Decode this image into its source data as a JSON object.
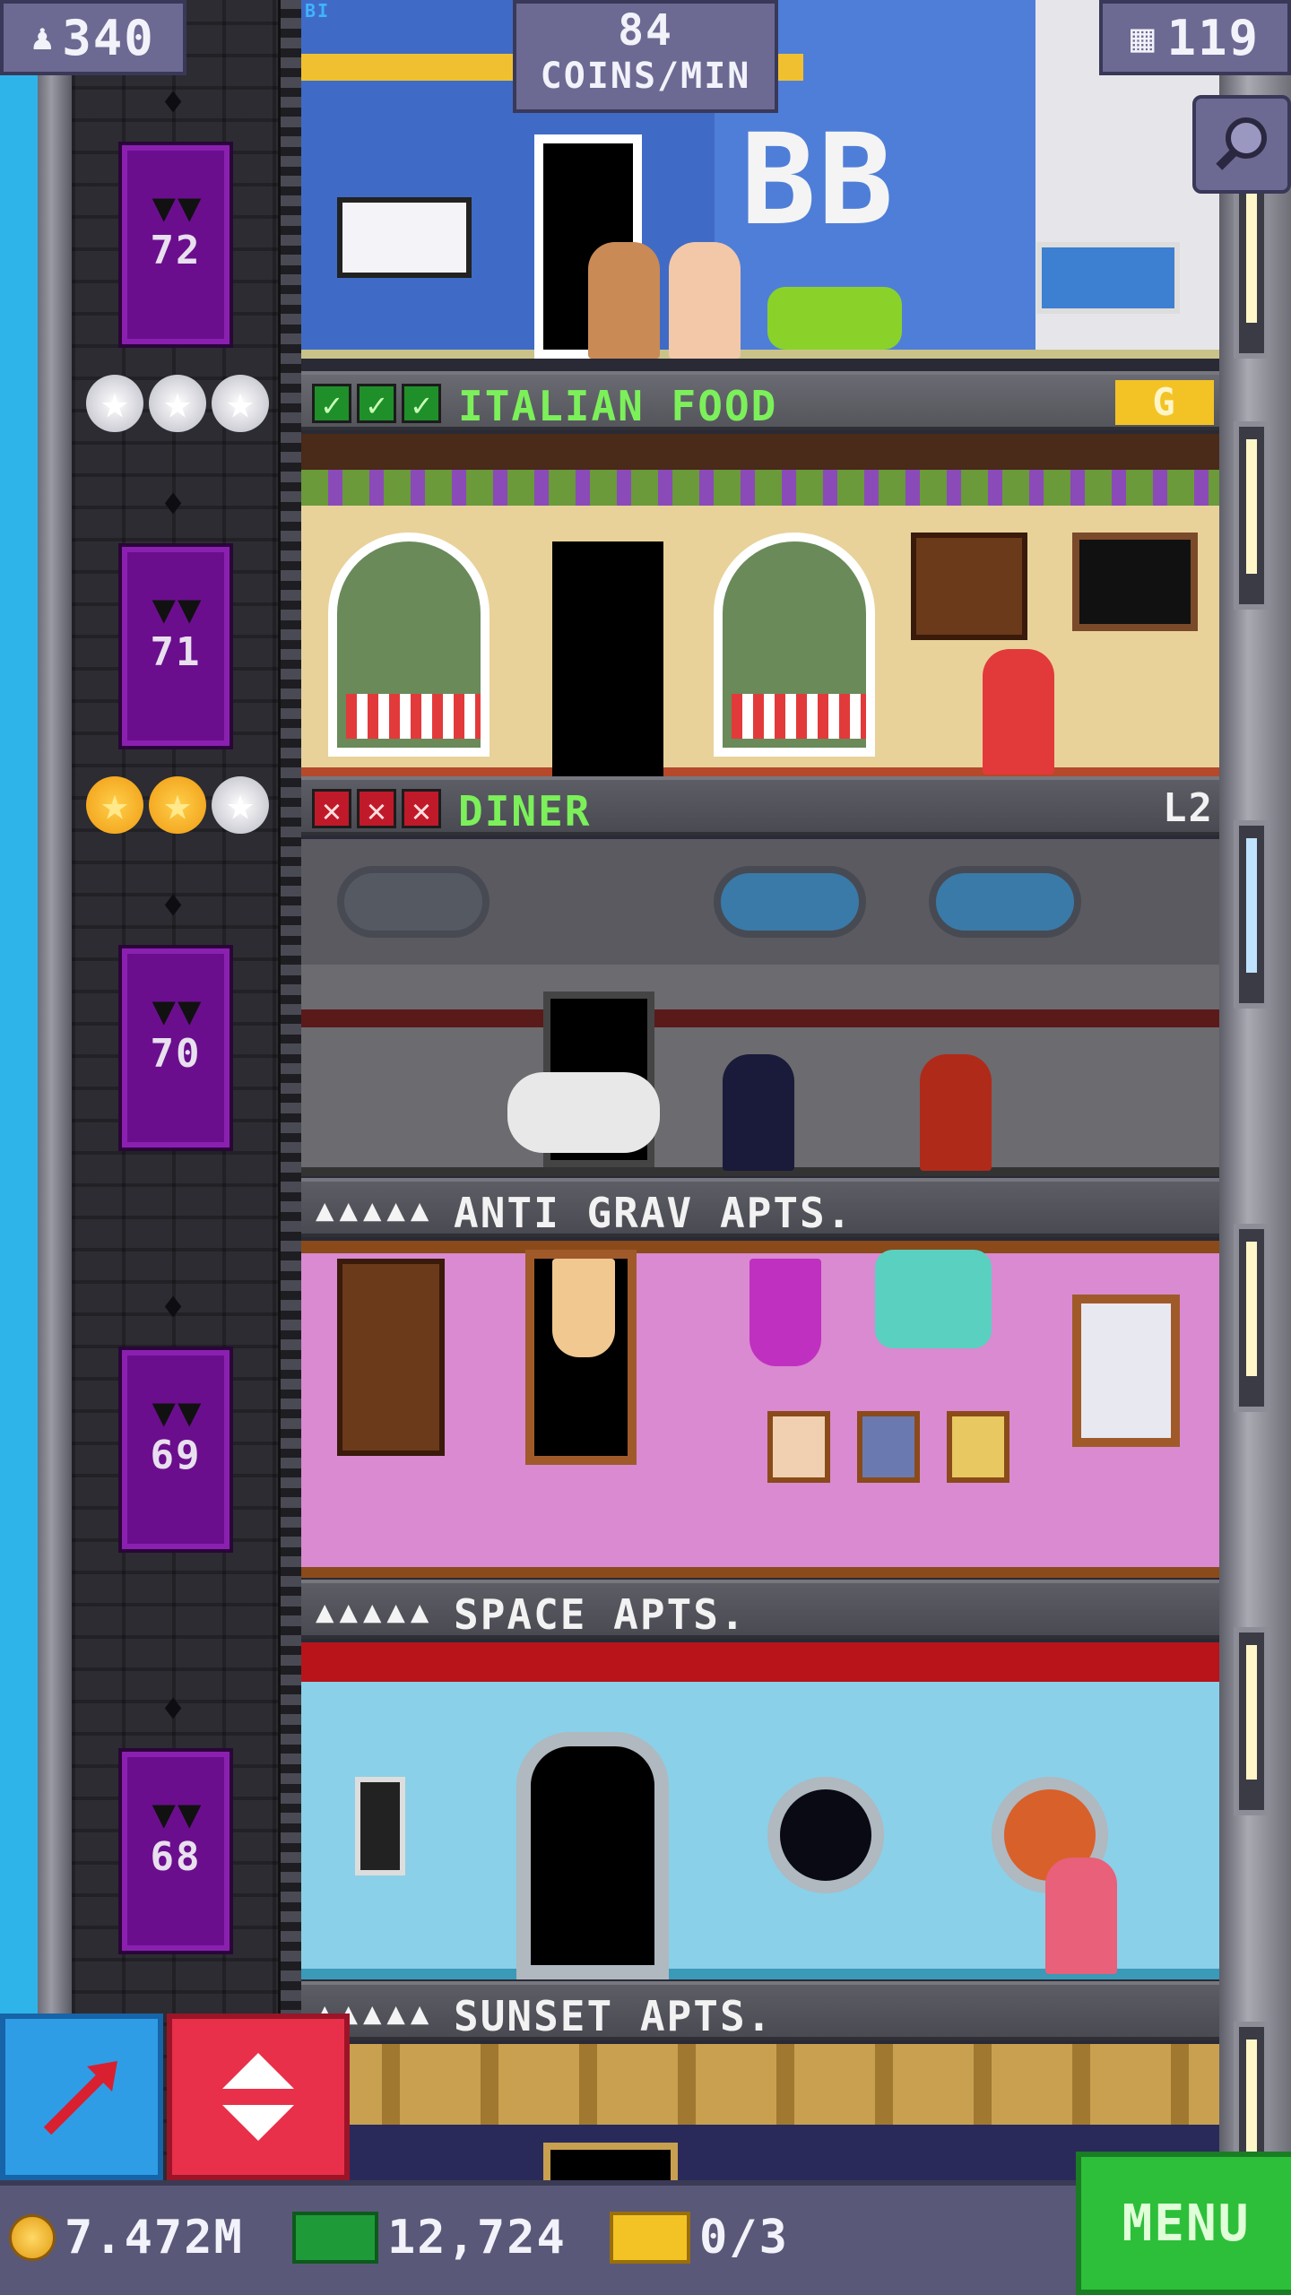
{
  "hud": {
    "population": "340",
    "coins_per_min_value": "84",
    "coins_per_min_label": "COINS/MIN",
    "floor_count": "119"
  },
  "floors": [
    {
      "label": "ITALIAN FOOD",
      "level_badge": "G",
      "marks": [
        "ok",
        "ok",
        "ok"
      ],
      "stars": [
        "silver",
        "silver",
        "silver"
      ]
    },
    {
      "label": "DINER",
      "level_badge": "L2",
      "marks": [
        "x",
        "x",
        "x"
      ],
      "stars": [
        "gold",
        "gold",
        "silver"
      ]
    },
    {
      "label": "ANTI GRAV APTS.",
      "residents": "▲▲▲▲▲"
    },
    {
      "label": "SPACE APTS.",
      "residents": "▲▲▲▲▲"
    },
    {
      "label": "SUNSET APTS.",
      "residents": "▲▲▲▲▲"
    }
  ],
  "top_room": {
    "sign": "BB",
    "label_fragment": "BI"
  },
  "elevators": [
    "72",
    "71",
    "70",
    "69",
    "68"
  ],
  "bottom_bar": {
    "coins": "7.472M",
    "bux": "12,724",
    "tickets": "0/3",
    "menu_label": "MENU"
  },
  "colors": {
    "sky": "#2fb4ea",
    "elevator": "#6b0e8e",
    "hud_badge": "#6c6a92",
    "menu_green": "#2dbf3a",
    "build_blue": "#2e9de6",
    "elevator_red": "#e8304a",
    "label_green": "#7cf05a"
  },
  "icons": [
    "person-icon",
    "building-icon",
    "search-icon",
    "bat-icon",
    "build-arrow-icon",
    "elevator-arrows-icon",
    "coin-icon",
    "bux-icon",
    "ticket-icon",
    "check-icon",
    "x-icon"
  ]
}
